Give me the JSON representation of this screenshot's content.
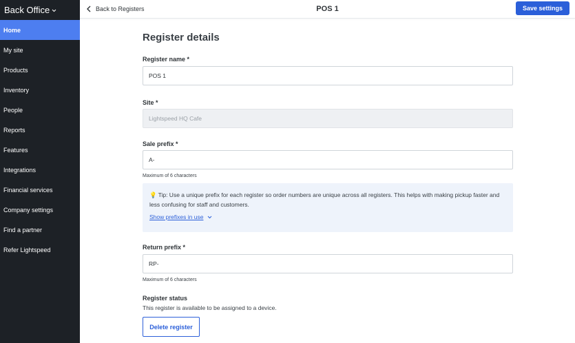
{
  "sidebar": {
    "brand": "Back Office",
    "items": [
      {
        "label": "Home",
        "active": true
      },
      {
        "label": "My site"
      },
      {
        "label": "Products"
      },
      {
        "label": "Inventory"
      },
      {
        "label": "People"
      },
      {
        "label": "Reports"
      },
      {
        "label": "Features"
      },
      {
        "label": "Integrations"
      },
      {
        "label": "Financial services"
      },
      {
        "label": "Company settings"
      },
      {
        "label": "Find a partner"
      },
      {
        "label": "Refer Lightspeed"
      }
    ]
  },
  "header": {
    "back_label": "Back to Registers",
    "title": "POS 1",
    "save_label": "Save settings"
  },
  "form": {
    "section_title": "Register details",
    "register_name": {
      "label": "Register name *",
      "value": "POS 1"
    },
    "site": {
      "label": "Site *",
      "value": "Lightspeed HQ Cafe"
    },
    "sale_prefix": {
      "label": "Sale prefix *",
      "value": "A-",
      "hint": "Maximum of 6 characters"
    },
    "tip": {
      "text": "Tip: Use a unique prefix for each register so order numbers are unique across all registers. This helps with making pickup faster and less confusing for staff and customers.",
      "link": "Show prefixes in use"
    },
    "return_prefix": {
      "label": "Return prefix *",
      "value": "RP-",
      "hint": "Maximum of 6 characters"
    },
    "status": {
      "title": "Register status",
      "text": "This register is available to be assigned to a device.",
      "delete_label": "Delete register"
    }
  },
  "colors": {
    "sidebar_bg": "#1d2126",
    "active_item": "#4d7ef0",
    "primary": "#2b5fd9",
    "tip_bg": "#eef3fb"
  }
}
